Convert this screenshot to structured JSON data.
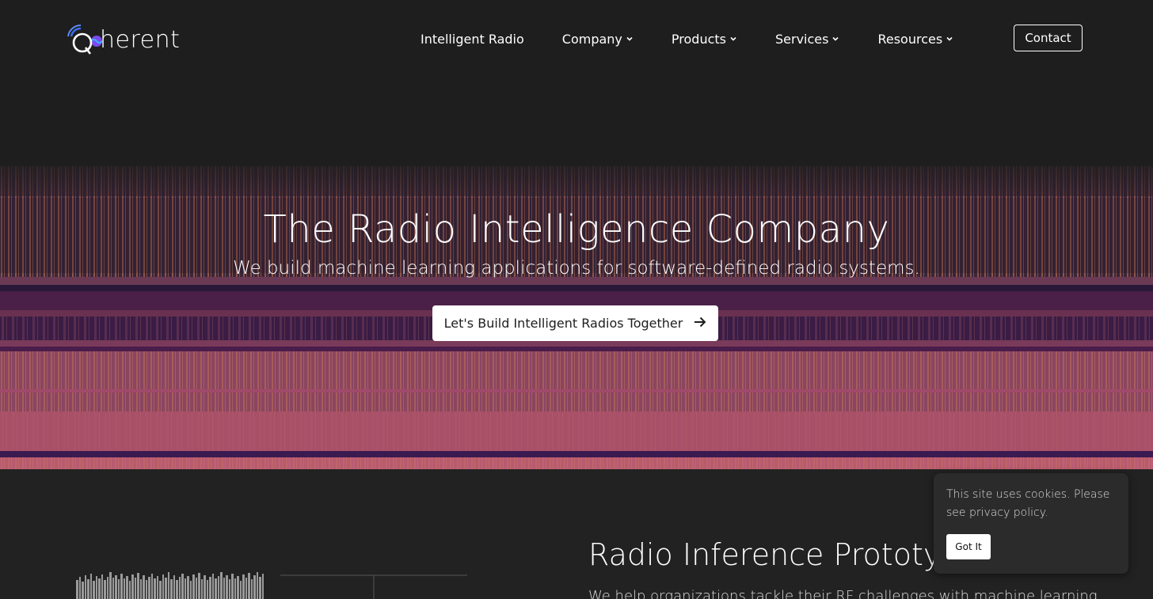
{
  "header": {
    "logo_text": "Qoherent",
    "logo_suffix": "herent",
    "nav": [
      {
        "label": "Intelligent Radio",
        "dropdown": false
      },
      {
        "label": "Company",
        "dropdown": true
      },
      {
        "label": "Products",
        "dropdown": true
      },
      {
        "label": "Services",
        "dropdown": true
      },
      {
        "label": "Resources",
        "dropdown": true
      }
    ],
    "contact_label": "Contact"
  },
  "hero": {
    "title": "The Radio Intelligence Company",
    "subtitle": "We build machine learning applications for software-defined radio systems.",
    "cta_label": "Let's Build Intelligent Radios Together",
    "cta_icon": "arrow-right-icon"
  },
  "section": {
    "title": "Radio Inference Prototyp",
    "description": "We help organizations tackle their RF challenges with machine learning"
  },
  "cookie": {
    "text": "This site uses cookies. Please see privacy policy.",
    "button_label": "Got It"
  },
  "colors": {
    "background": "#1e1e1e",
    "spectro_dark": "#2a1a3a",
    "spectro_purple": "#5a2a6a",
    "spectro_orange": "#c46a50",
    "spectro_pink": "#a84a6a",
    "logo_blue": "#3a6ef0",
    "logo_purple": "#9a4af0"
  }
}
